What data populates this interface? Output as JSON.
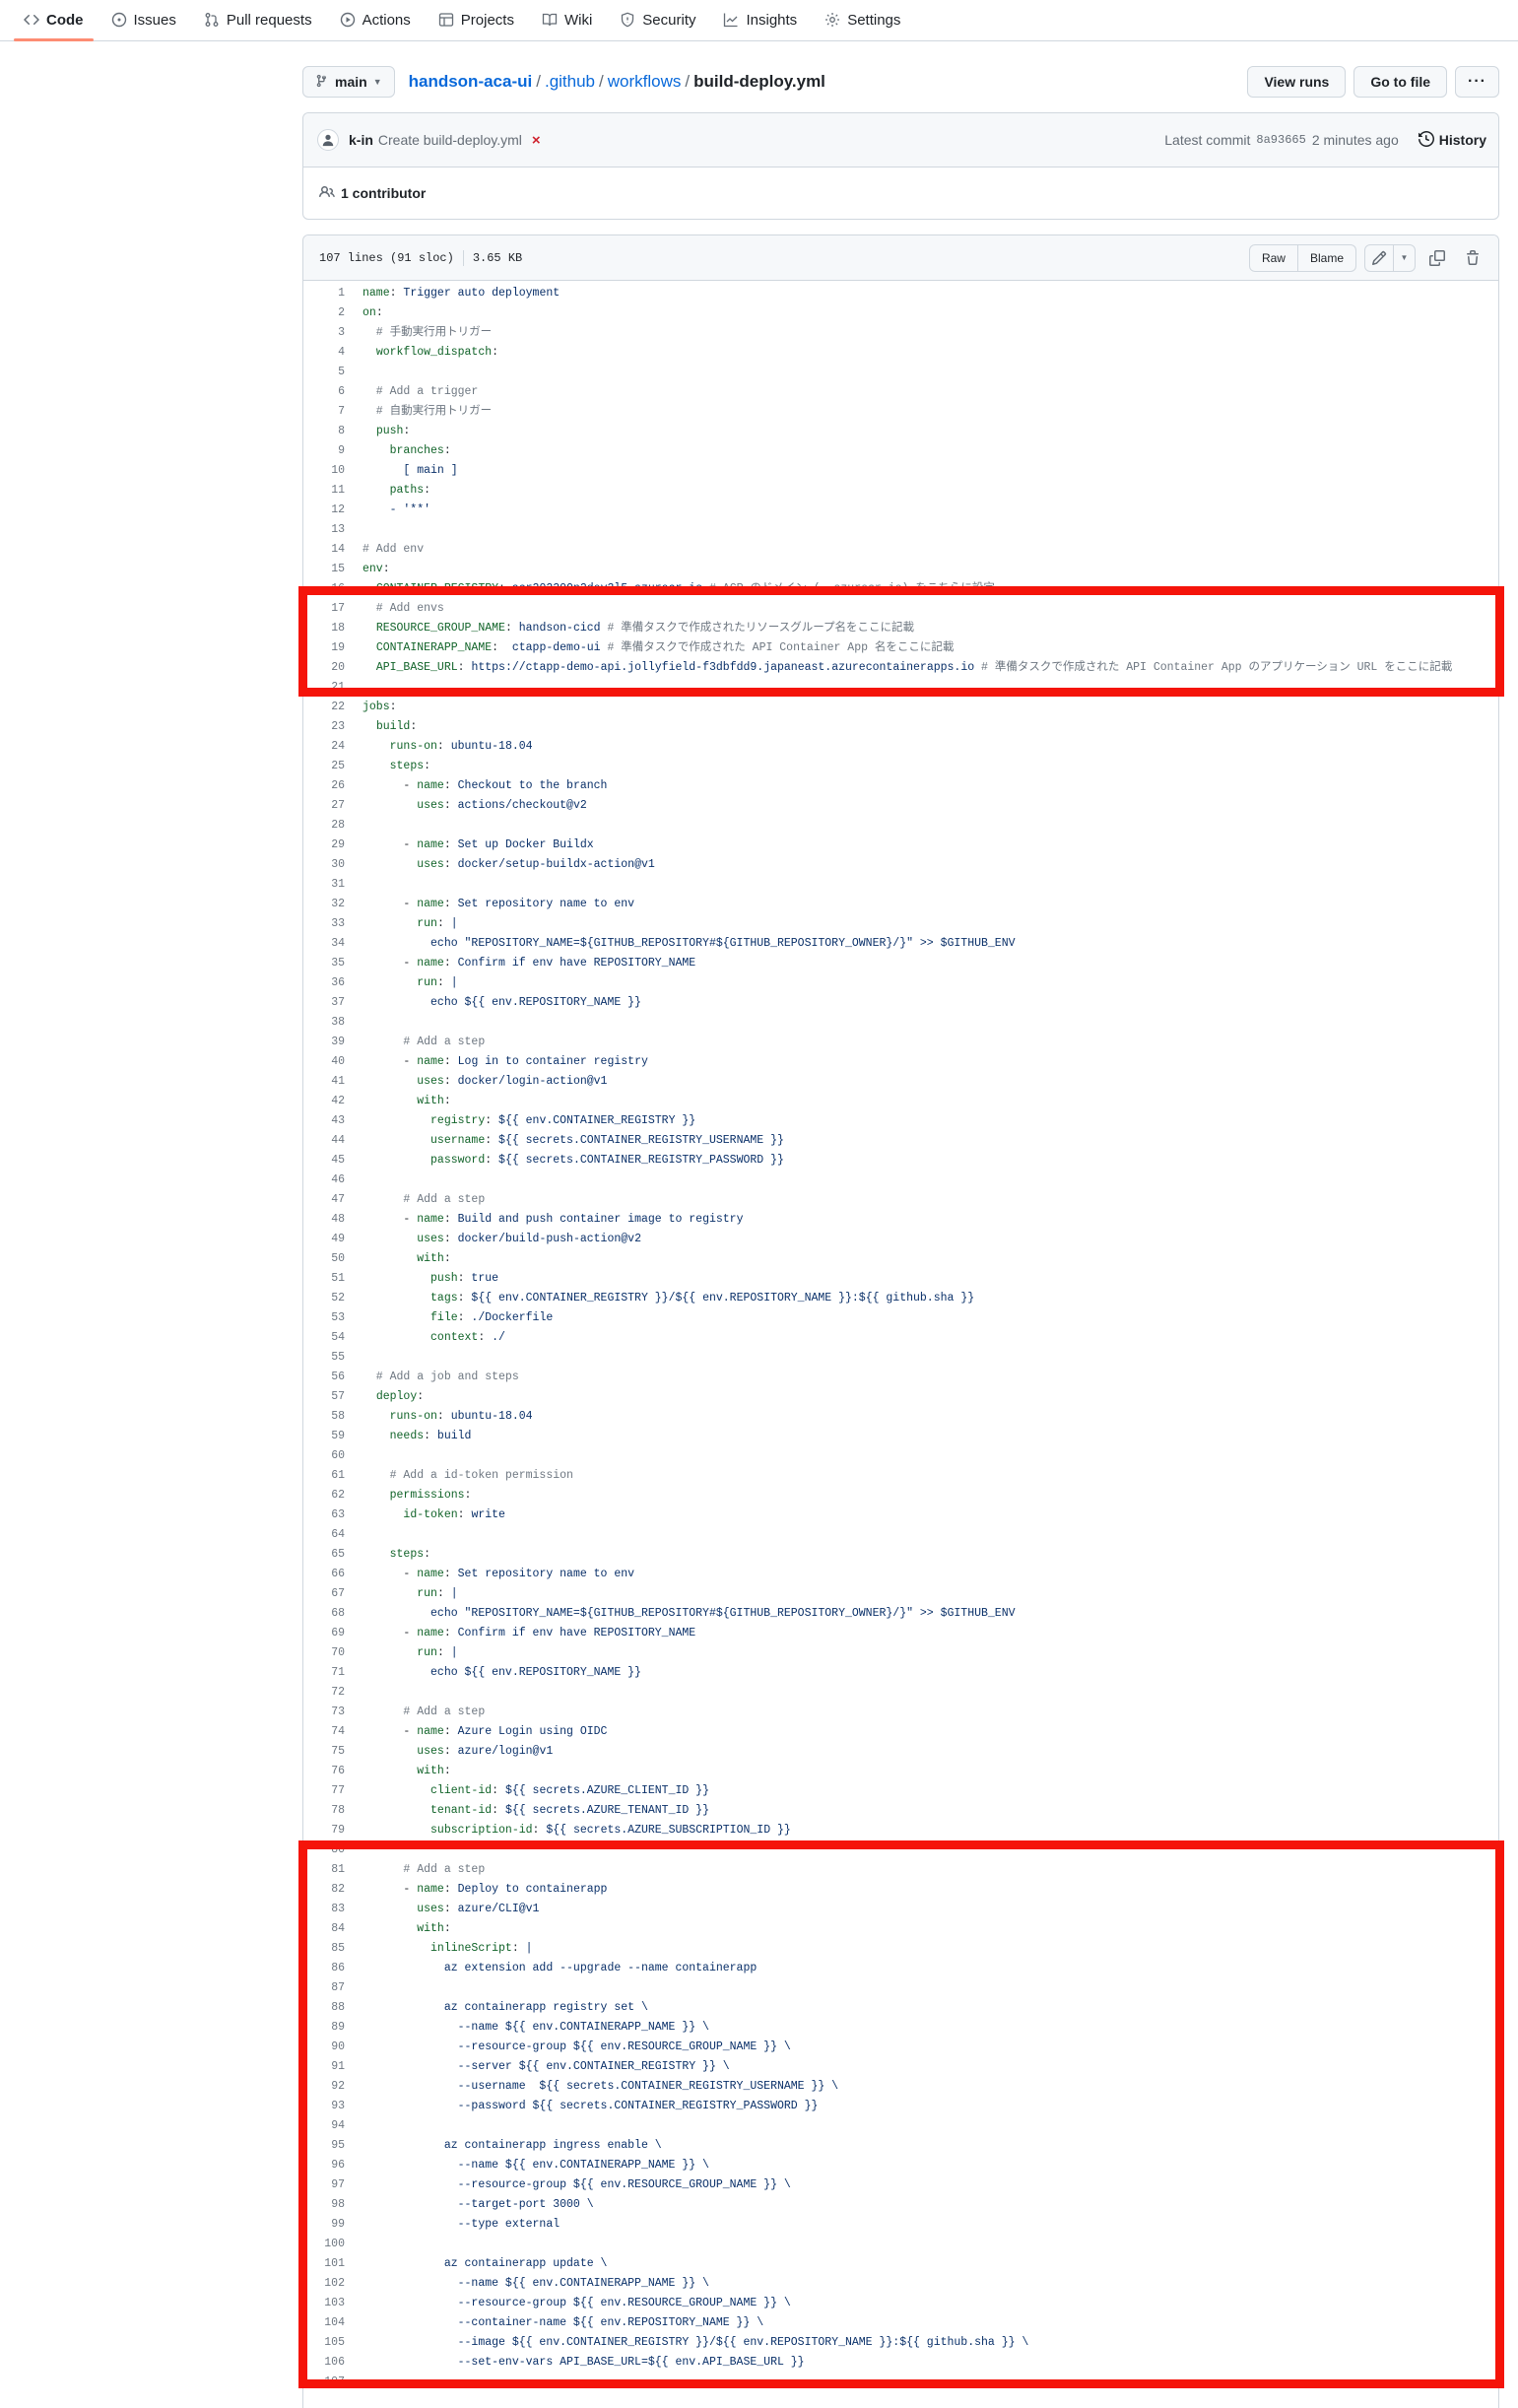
{
  "nav": {
    "items": [
      {
        "label": "Code",
        "icon": "code-icon",
        "active": true
      },
      {
        "label": "Issues",
        "icon": "issue-icon",
        "active": false
      },
      {
        "label": "Pull requests",
        "icon": "pull-request-icon",
        "active": false
      },
      {
        "label": "Actions",
        "icon": "play-icon",
        "active": false
      },
      {
        "label": "Projects",
        "icon": "table-icon",
        "active": false
      },
      {
        "label": "Wiki",
        "icon": "book-icon",
        "active": false
      },
      {
        "label": "Security",
        "icon": "shield-icon",
        "active": false
      },
      {
        "label": "Insights",
        "icon": "graph-icon",
        "active": false
      },
      {
        "label": "Settings",
        "icon": "gear-icon",
        "active": false
      }
    ]
  },
  "breadcrumb": {
    "branch": "main",
    "repo": "handson-aca-ui",
    "sep": "/",
    "dir1": ".github",
    "dir2": "workflows",
    "file": "build-deploy.yml",
    "view_runs": "View runs",
    "go_to_file": "Go to file",
    "more": "···"
  },
  "commit": {
    "author": "k-in",
    "message": "Create build-deploy.yml",
    "status": "×",
    "latest_label": "Latest commit",
    "sha": "8a93665",
    "time": "2 minutes ago",
    "history": "History",
    "contributors_count": "1 contributor"
  },
  "file": {
    "lines_info": "107 lines (91 sloc)",
    "size": "3.65 KB",
    "raw": "Raw",
    "blame": "Blame",
    "lines": [
      {
        "n": "1",
        "t": "name: Trigger auto deployment"
      },
      {
        "n": "2",
        "t": "on:"
      },
      {
        "n": "3",
        "t": "  # 手動実行用トリガー"
      },
      {
        "n": "4",
        "t": "  workflow_dispatch:"
      },
      {
        "n": "5",
        "t": ""
      },
      {
        "n": "6",
        "t": "  # Add a trigger"
      },
      {
        "n": "7",
        "t": "  # 自動実行用トリガー"
      },
      {
        "n": "8",
        "t": "  push:"
      },
      {
        "n": "9",
        "t": "    branches:"
      },
      {
        "n": "10",
        "t": "      [ main ]"
      },
      {
        "n": "11",
        "t": "    paths:"
      },
      {
        "n": "12",
        "t": "    - '**'"
      },
      {
        "n": "13",
        "t": ""
      },
      {
        "n": "14",
        "t": "# Add env"
      },
      {
        "n": "15",
        "t": "env:"
      },
      {
        "n": "16",
        "t": "  CONTAINER_REGISTRY: acr202209n2dev3l5.azurecr.io # ACR のドメイン (~.azurecr.io) をこちらに設定"
      },
      {
        "n": "17",
        "t": "  # Add envs"
      },
      {
        "n": "18",
        "t": "  RESOURCE_GROUP_NAME: handson-cicd # 準備タスクで作成されたリソースグループ名をここに記載"
      },
      {
        "n": "19",
        "t": "  CONTAINERAPP_NAME:  ctapp-demo-ui # 準備タスクで作成された API Container App 名をここに記載"
      },
      {
        "n": "20",
        "t": "  API_BASE_URL: https://ctapp-demo-api.jollyfield-f3dbfdd9.japaneast.azurecontainerapps.io # 準備タスクで作成された API Container App のアプリケーション URL をここに記載"
      },
      {
        "n": "21",
        "t": ""
      },
      {
        "n": "22",
        "t": "jobs:"
      },
      {
        "n": "23",
        "t": "  build:"
      },
      {
        "n": "24",
        "t": "    runs-on: ubuntu-18.04"
      },
      {
        "n": "25",
        "t": "    steps:"
      },
      {
        "n": "26",
        "t": "      - name: Checkout to the branch"
      },
      {
        "n": "27",
        "t": "        uses: actions/checkout@v2"
      },
      {
        "n": "28",
        "t": ""
      },
      {
        "n": "29",
        "t": "      - name: Set up Docker Buildx"
      },
      {
        "n": "30",
        "t": "        uses: docker/setup-buildx-action@v1"
      },
      {
        "n": "31",
        "t": ""
      },
      {
        "n": "32",
        "t": "      - name: Set repository name to env"
      },
      {
        "n": "33",
        "t": "        run: |"
      },
      {
        "n": "34",
        "t": "          echo \"REPOSITORY_NAME=${GITHUB_REPOSITORY#${GITHUB_REPOSITORY_OWNER}/}\" >> $GITHUB_ENV"
      },
      {
        "n": "35",
        "t": "      - name: Confirm if env have REPOSITORY_NAME"
      },
      {
        "n": "36",
        "t": "        run: |"
      },
      {
        "n": "37",
        "t": "          echo ${{ env.REPOSITORY_NAME }}"
      },
      {
        "n": "38",
        "t": ""
      },
      {
        "n": "39",
        "t": "      # Add a step"
      },
      {
        "n": "40",
        "t": "      - name: Log in to container registry"
      },
      {
        "n": "41",
        "t": "        uses: docker/login-action@v1"
      },
      {
        "n": "42",
        "t": "        with:"
      },
      {
        "n": "43",
        "t": "          registry: ${{ env.CONTAINER_REGISTRY }}"
      },
      {
        "n": "44",
        "t": "          username: ${{ secrets.CONTAINER_REGISTRY_USERNAME }}"
      },
      {
        "n": "45",
        "t": "          password: ${{ secrets.CONTAINER_REGISTRY_PASSWORD }}"
      },
      {
        "n": "46",
        "t": ""
      },
      {
        "n": "47",
        "t": "      # Add a step"
      },
      {
        "n": "48",
        "t": "      - name: Build and push container image to registry"
      },
      {
        "n": "49",
        "t": "        uses: docker/build-push-action@v2"
      },
      {
        "n": "50",
        "t": "        with:"
      },
      {
        "n": "51",
        "t": "          push: true"
      },
      {
        "n": "52",
        "t": "          tags: ${{ env.CONTAINER_REGISTRY }}/${{ env.REPOSITORY_NAME }}:${{ github.sha }}"
      },
      {
        "n": "53",
        "t": "          file: ./Dockerfile"
      },
      {
        "n": "54",
        "t": "          context: ./"
      },
      {
        "n": "55",
        "t": ""
      },
      {
        "n": "56",
        "t": "  # Add a job and steps"
      },
      {
        "n": "57",
        "t": "  deploy:"
      },
      {
        "n": "58",
        "t": "    runs-on: ubuntu-18.04"
      },
      {
        "n": "59",
        "t": "    needs: build"
      },
      {
        "n": "60",
        "t": ""
      },
      {
        "n": "61",
        "t": "    # Add a id-token permission"
      },
      {
        "n": "62",
        "t": "    permissions:"
      },
      {
        "n": "63",
        "t": "      id-token: write"
      },
      {
        "n": "64",
        "t": ""
      },
      {
        "n": "65",
        "t": "    steps:"
      },
      {
        "n": "66",
        "t": "      - name: Set repository name to env"
      },
      {
        "n": "67",
        "t": "        run: |"
      },
      {
        "n": "68",
        "t": "          echo \"REPOSITORY_NAME=${GITHUB_REPOSITORY#${GITHUB_REPOSITORY_OWNER}/}\" >> $GITHUB_ENV"
      },
      {
        "n": "69",
        "t": "      - name: Confirm if env have REPOSITORY_NAME"
      },
      {
        "n": "70",
        "t": "        run: |"
      },
      {
        "n": "71",
        "t": "          echo ${{ env.REPOSITORY_NAME }}"
      },
      {
        "n": "72",
        "t": ""
      },
      {
        "n": "73",
        "t": "      # Add a step"
      },
      {
        "n": "74",
        "t": "      - name: Azure Login using OIDC"
      },
      {
        "n": "75",
        "t": "        uses: azure/login@v1"
      },
      {
        "n": "76",
        "t": "        with:"
      },
      {
        "n": "77",
        "t": "          client-id: ${{ secrets.AZURE_CLIENT_ID }}"
      },
      {
        "n": "78",
        "t": "          tenant-id: ${{ secrets.AZURE_TENANT_ID }}"
      },
      {
        "n": "79",
        "t": "          subscription-id: ${{ secrets.AZURE_SUBSCRIPTION_ID }}"
      },
      {
        "n": "80",
        "t": ""
      },
      {
        "n": "81",
        "t": "      # Add a step"
      },
      {
        "n": "82",
        "t": "      - name: Deploy to containerapp"
      },
      {
        "n": "83",
        "t": "        uses: azure/CLI@v1"
      },
      {
        "n": "84",
        "t": "        with:"
      },
      {
        "n": "85",
        "t": "          inlineScript: |"
      },
      {
        "n": "86",
        "t": "            az extension add --upgrade --name containerapp"
      },
      {
        "n": "87",
        "t": ""
      },
      {
        "n": "88",
        "t": "            az containerapp registry set \\"
      },
      {
        "n": "89",
        "t": "              --name ${{ env.CONTAINERAPP_NAME }} \\"
      },
      {
        "n": "90",
        "t": "              --resource-group ${{ env.RESOURCE_GROUP_NAME }} \\"
      },
      {
        "n": "91",
        "t": "              --server ${{ env.CONTAINER_REGISTRY }} \\"
      },
      {
        "n": "92",
        "t": "              --username  ${{ secrets.CONTAINER_REGISTRY_USERNAME }} \\"
      },
      {
        "n": "93",
        "t": "              --password ${{ secrets.CONTAINER_REGISTRY_PASSWORD }}"
      },
      {
        "n": "94",
        "t": ""
      },
      {
        "n": "95",
        "t": "            az containerapp ingress enable \\"
      },
      {
        "n": "96",
        "t": "              --name ${{ env.CONTAINERAPP_NAME }} \\"
      },
      {
        "n": "97",
        "t": "              --resource-group ${{ env.RESOURCE_GROUP_NAME }} \\"
      },
      {
        "n": "98",
        "t": "              --target-port 3000 \\"
      },
      {
        "n": "99",
        "t": "              --type external"
      },
      {
        "n": "100",
        "t": ""
      },
      {
        "n": "101",
        "t": "            az containerapp update \\"
      },
      {
        "n": "102",
        "t": "              --name ${{ env.CONTAINERAPP_NAME }} \\"
      },
      {
        "n": "103",
        "t": "              --resource-group ${{ env.RESOURCE_GROUP_NAME }} \\"
      },
      {
        "n": "104",
        "t": "              --container-name ${{ env.REPOSITORY_NAME }} \\"
      },
      {
        "n": "105",
        "t": "              --image ${{ env.CONTAINER_REGISTRY }}/${{ env.REPOSITORY_NAME }}:${{ github.sha }} \\"
      },
      {
        "n": "106",
        "t": "              --set-env-vars API_BASE_URL=${{ env.API_BASE_URL }}"
      },
      {
        "n": "107",
        "t": ""
      }
    ]
  },
  "colors": {
    "accent": "#0969da",
    "highlight": "#f5140a",
    "nav_underline": "#fd8c73"
  }
}
